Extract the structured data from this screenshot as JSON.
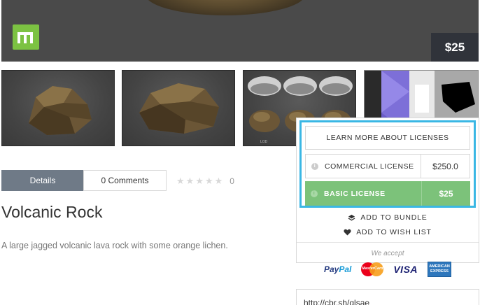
{
  "hero": {
    "price": "$25",
    "brand_icon": "m-logo-icon"
  },
  "thumbnails": [
    {
      "label": "rock-front"
    },
    {
      "label": "rock-side"
    },
    {
      "label": "rock-variants",
      "caption": "LOD"
    },
    {
      "label": "texture-maps"
    }
  ],
  "tabs": {
    "details": "Details",
    "comments": "0 Comments"
  },
  "rating": {
    "stars": 0,
    "max": 5,
    "count": "0"
  },
  "product": {
    "title": "Volcanic Rock",
    "description": "A large jagged volcanic lava rock with some orange lichen."
  },
  "licenses": {
    "learn_more": "LEARN MORE ABOUT LICENSES",
    "commercial": {
      "name": "COMMERCIAL LICENSE",
      "price": "$250.0"
    },
    "basic": {
      "name": "BASIC LICENSE",
      "price": "$25"
    },
    "info_glyph": "i"
  },
  "actions": {
    "add_bundle": "ADD TO BUNDLE",
    "add_wish": "ADD TO WISH LIST"
  },
  "payment": {
    "we_accept": "We accept",
    "paypal_a": "Pay",
    "paypal_b": "Pal",
    "mastercard": "MasterCard",
    "visa": "VISA",
    "amex_a": "AMERICAN",
    "amex_b": "EXPRESS"
  },
  "share": {
    "url": "http://cbr.sh/qlsae"
  },
  "colors": {
    "accent_blue": "#3ab7e4",
    "basic_green": "#7cc27a",
    "tab_gray": "#6f7a87",
    "brand_green": "#7cc242"
  }
}
